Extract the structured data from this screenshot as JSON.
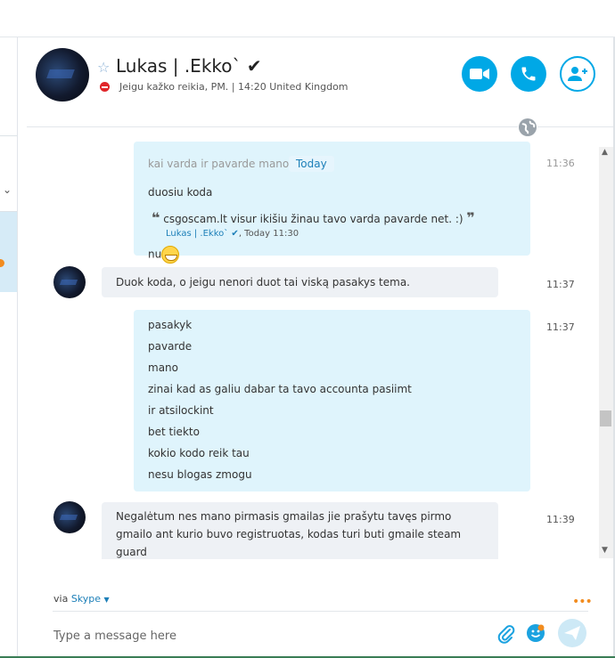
{
  "header": {
    "contact_name": "Lukas | .Ekko`",
    "verified_mark": "✔",
    "status_text": "Jeigu kažko reikia, PM.",
    "separator": "|",
    "local_time": "14:20 United Kingdom"
  },
  "chat": {
    "date_label": "Today",
    "messages": [
      {
        "direction": "out",
        "lines": [
          "kai varda ir pavarde mano",
          "duosiu koda"
        ],
        "time": "11:36",
        "quote": {
          "text": "csgoscam.lt visur ikišiu žinau tavo varda pavarde net. :)",
          "author": "Lukas | .Ekko` ✔",
          "when": ", Today 11:30"
        },
        "after_quote": "nu"
      },
      {
        "direction": "in",
        "lines": [
          "Duok koda, o jeigu nenori duot tai viską pasakys tema."
        ],
        "time": "11:37"
      },
      {
        "direction": "out",
        "lines": [
          "pasakyk",
          "pavarde",
          "mano",
          "zinai kad as galiu dabar ta tavo accounta pasiimt",
          "ir atsilockint",
          "bet tiekto",
          "kokio kodo reik tau",
          "nesu blogas zmogu"
        ],
        "time": "11:37"
      },
      {
        "direction": "in",
        "lines": [
          "Negalėtum nes mano pirmasis gmailas jie prašytu tavęs pirmo",
          "gmailo ant kurio buvo registruotas, kodas turi buti gmaile steam",
          "guard"
        ],
        "time": "11:39"
      }
    ]
  },
  "composer": {
    "via_label": "via",
    "via_service": "Skype",
    "placeholder": "Type a message here"
  },
  "colors": {
    "accent": "#00a8e6",
    "outgoing_bubble": "#dff4fc",
    "incoming_bubble": "#eef1f5",
    "busy_status": "#e0262a"
  },
  "icons": [
    "star-icon",
    "dnd-status-icon",
    "video-camera-icon",
    "phone-icon",
    "add-contact-icon",
    "globe-icon",
    "attach-icon",
    "emoji-icon",
    "send-icon",
    "more-icon",
    "chevron-down-icon"
  ]
}
